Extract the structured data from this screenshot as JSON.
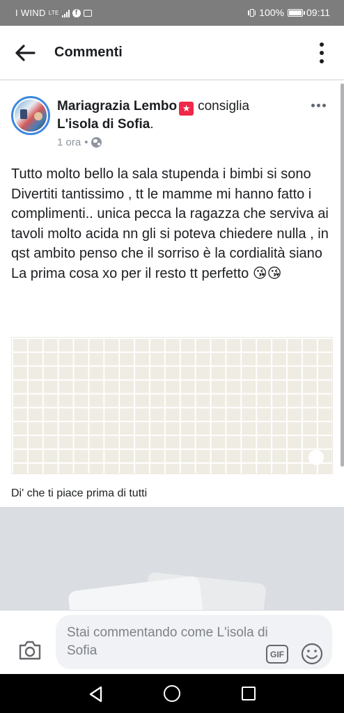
{
  "status_bar": {
    "carrier": "I WIND",
    "network": "LTE",
    "battery": "100%",
    "time": "09:11",
    "icons": [
      "signal-icon",
      "facebook-notification-icon",
      "gallery-notification-icon",
      "vibrate-icon",
      "battery-icon"
    ]
  },
  "app_bar": {
    "title": "Commenti",
    "back_icon": "arrow-left-icon",
    "more_icon": "more-vertical-icon"
  },
  "post": {
    "author": "Mariagrazia Lembo",
    "badge_icon": "recommend-star-icon",
    "verb": "consiglia",
    "page": "L'isola di Sofia",
    "page_suffix": ".",
    "time": "1 ora",
    "separator": "•",
    "privacy_icon": "globe-icon",
    "more_icon": "more-horizontal-icon",
    "text": "Tutto molto bello la sala stupenda i bimbi si sono\nDivertiti tantissimo , tt le mamme mi hanno fatto i complimenti.. unica pecca la ragazza che serviva ai tavoli molto acida nn gli si poteva chiedere nulla , in qst ambito penso che il sorriso è la cordialità siano La prima cosa xo per il resto tt perfetto 😘😘",
    "like_prompt": "Di' che ti piace prima di tutti"
  },
  "composer": {
    "placeholder": "Stai commentando come L'isola di Sofia",
    "gif_label": "GIF",
    "camera_icon": "camera-icon",
    "emoji_icon": "smiley-icon"
  },
  "nav_bar": {
    "icons": [
      "nav-back-icon",
      "nav-home-icon",
      "nav-recent-apps-icon"
    ]
  },
  "colors": {
    "accent": "#3b88e0",
    "badge": "#f02849",
    "text": "#1c1e21",
    "muted": "#8d949e"
  }
}
